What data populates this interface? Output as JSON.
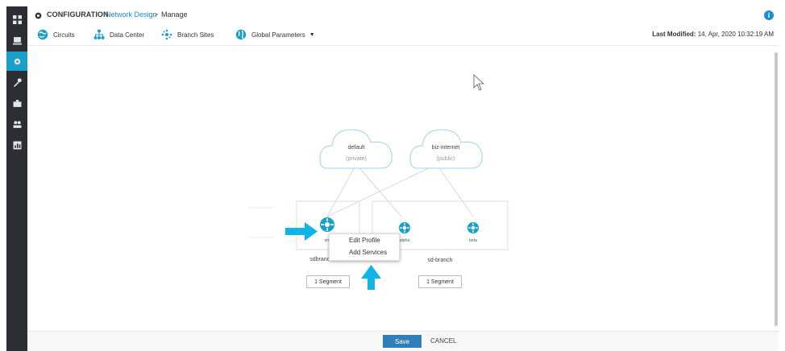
{
  "header": {
    "title": "CONFIGURATION",
    "breadcrumb_link": "Network Design",
    "breadcrumb_sep": ">",
    "breadcrumb_current": "Manage",
    "info_icon": "info-icon"
  },
  "toolbar": {
    "tabs": [
      {
        "label": "Circuits",
        "icon": "globe-icon"
      },
      {
        "label": "Data Center",
        "icon": "datacenter-icon"
      },
      {
        "label": "Branch Sites",
        "icon": "branch-icon"
      },
      {
        "label": "Global Parameters",
        "icon": "globe-icon"
      }
    ],
    "last_modified_label": "Last Modified:",
    "last_modified_value": "14, Apr, 2020 10:32:19 AM"
  },
  "diagram": {
    "clouds": [
      {
        "name": "default",
        "sub": "(private)"
      },
      {
        "name": "biz-internet",
        "sub": "(public)"
      }
    ],
    "nodes": [
      {
        "label": "sm"
      },
      {
        "label": "alpha"
      },
      {
        "label": "beta"
      }
    ],
    "groups": [
      {
        "label": "sdbranch-small",
        "segment": "1 Segment"
      },
      {
        "label": "sd-branch",
        "segment": "1 Segment"
      }
    ]
  },
  "context_menu": {
    "items": [
      "Edit Profile",
      "Add Services"
    ]
  },
  "footer": {
    "save_label": "Save",
    "cancel_label": "CANCEL"
  },
  "colors": {
    "accent": "#1aa0c8",
    "arrow": "#12b3e6",
    "save": "#2f7fb8",
    "cloud_stroke": "#9fd3e8",
    "group_border": "#efd7c8"
  }
}
